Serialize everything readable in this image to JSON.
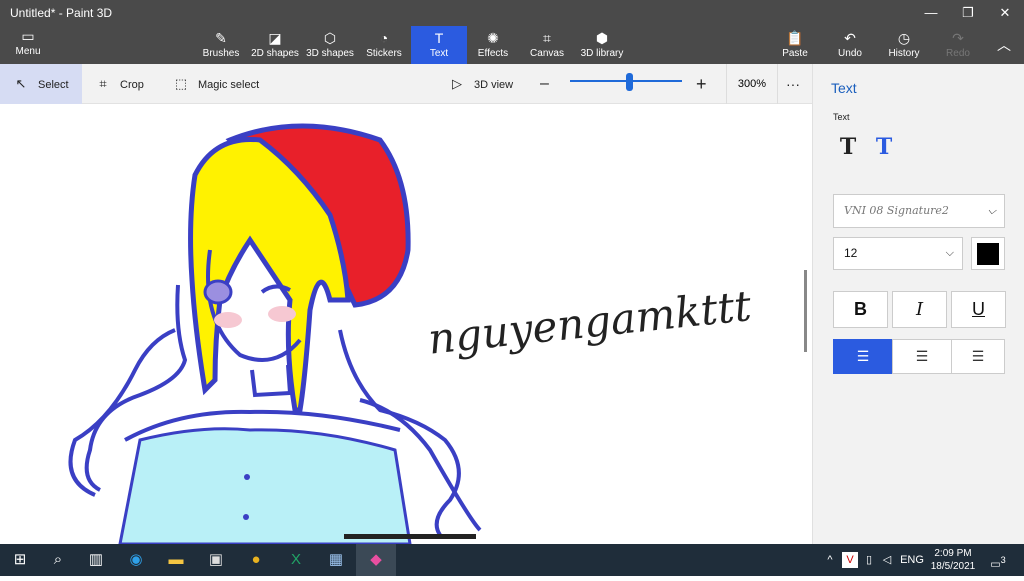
{
  "window": {
    "title": "Untitled* - Paint 3D",
    "minimize": "—",
    "restore": "❐",
    "close": "✕"
  },
  "ribbon": {
    "menu": "Menu",
    "tabs": [
      {
        "label": "Brushes",
        "icon": "brush-icon"
      },
      {
        "label": "2D shapes",
        "icon": "2d-shapes-icon"
      },
      {
        "label": "3D shapes",
        "icon": "3d-shapes-icon"
      },
      {
        "label": "Stickers",
        "icon": "stickers-icon"
      },
      {
        "label": "Text",
        "icon": "text-icon"
      },
      {
        "label": "Effects",
        "icon": "effects-icon"
      },
      {
        "label": "Canvas",
        "icon": "canvas-icon"
      },
      {
        "label": "3D library",
        "icon": "3d-library-icon"
      }
    ],
    "right": [
      {
        "label": "Paste",
        "icon": "paste-icon"
      },
      {
        "label": "Undo",
        "icon": "undo-icon"
      },
      {
        "label": "History",
        "icon": "history-icon"
      },
      {
        "label": "Redo",
        "icon": "redo-icon"
      }
    ]
  },
  "toolbar": {
    "select": "Select",
    "crop": "Crop",
    "magic_select": "Magic select",
    "view_3d": "3D view",
    "zoom": "300%",
    "zoom_level": 0.53
  },
  "canvas": {
    "text": "nguyengamkttt"
  },
  "panel": {
    "title": "Text",
    "section": "Text",
    "font": "VNI 08 Signature2",
    "size": "12",
    "color": "#000000",
    "bold": "B",
    "italic": "I",
    "underline": "U"
  },
  "taskbar": {
    "lang": "ENG",
    "time": "2:09 PM",
    "date": "18/5/2021",
    "notifications": "3"
  }
}
